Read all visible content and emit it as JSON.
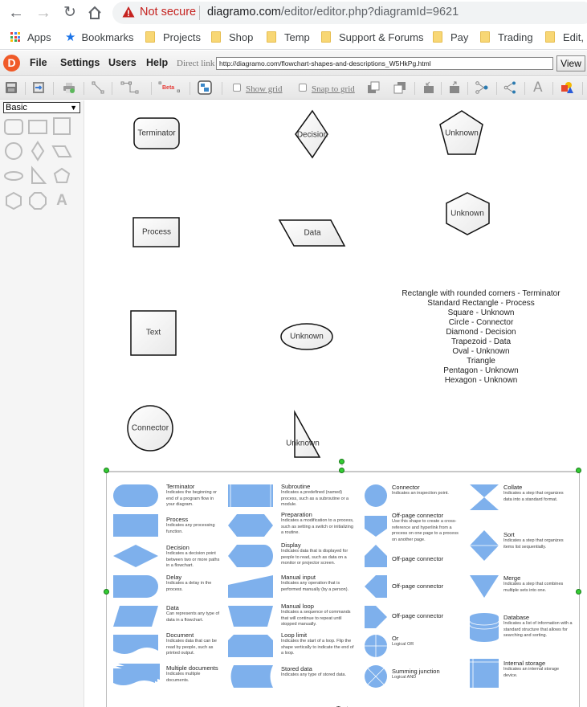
{
  "browser": {
    "security_label": "Not secure",
    "url_host": "diagramo.com",
    "url_path": "/editor/editor.php?diagramId=9621",
    "bookmarks": [
      {
        "label": "Apps",
        "icon": "apps-grid-icon"
      },
      {
        "label": "Bookmarks",
        "icon": "star-icon"
      },
      {
        "label": "Projects",
        "icon": "folder-icon"
      },
      {
        "label": "Shop",
        "icon": "folder-icon"
      },
      {
        "label": "Temp",
        "icon": "folder-icon"
      },
      {
        "label": "Support & Forums",
        "icon": "folder-icon"
      },
      {
        "label": "Pay",
        "icon": "folder-icon"
      },
      {
        "label": "Trading",
        "icon": "folder-icon"
      },
      {
        "label": "Edit, P",
        "icon": "folder-icon"
      }
    ]
  },
  "app": {
    "logo_letter": "D",
    "menu": [
      "File",
      "Settings",
      "Users",
      "Help"
    ],
    "direct_link_label": "Direct link :",
    "direct_link_value": "http://diagramo.com/flowchart-shapes-and-descriptions_W5HkPg.html",
    "view_button": "View",
    "toolbar": {
      "show_grid": "Show grid",
      "snap_to_grid": "Snap to grid",
      "beta_label": "Beta",
      "text_tool": "A"
    },
    "sidebar": {
      "shape_set": "Basic",
      "dropdown_arrow": "▼",
      "text_shape": "A"
    }
  },
  "canvas": {
    "figures": {
      "terminator": "Terminator",
      "decision": "Decision",
      "pentagon": "Unknown",
      "process": "Process",
      "data": "Data",
      "hexagon": "Unknown",
      "square": "Text",
      "oval": "Unknown",
      "circle": "Connector",
      "triangle": "Unknown"
    },
    "legend_lines": [
      "Rectangle with rounded corners - Terminator",
      "Standard Rectangle - Process",
      "Square - Unknown",
      "Circle - Connector",
      "Diamond - Decision",
      "Trapezoid - Data",
      "Oval - Unknown",
      "Triangle",
      "Pentagon - Unknown",
      "Hexagon - Unknown"
    ],
    "bottom_partial_label": "Text",
    "reference_image": {
      "shape_color": "#7eb0ec",
      "columns": [
        [
          {
            "title": "Terminator",
            "desc": "Indicates the beginning or end of a program flow in your diagram."
          },
          {
            "title": "Process",
            "desc": "Indicates any processing function."
          },
          {
            "title": "Decision",
            "desc": "Indicates a decision point between two or more paths in a flowchart."
          },
          {
            "title": "Delay",
            "desc": "Indicates a delay in the process."
          },
          {
            "title": "Data",
            "desc": "Can represents any type of data in a flowchart."
          },
          {
            "title": "Document",
            "desc": "Indicates data that can be read by people, such as printed output."
          },
          {
            "title": "Multiple documents",
            "desc": "Indicates multiple documents."
          }
        ],
        [
          {
            "title": "Subroutine",
            "desc": "Indicates a predefined (named) process, such as a subroutine or a module."
          },
          {
            "title": "Preparation",
            "desc": "Indicates a modification to a process, such as setting a switch or initializing a routine."
          },
          {
            "title": "Display",
            "desc": "Indicates data that is displayed for people to read, such as data on a monitor or projector screen."
          },
          {
            "title": "Manual input",
            "desc": "Indicates any operation that is performed manually (by a person)."
          },
          {
            "title": "Manual loop",
            "desc": "Indicates a sequence of commands that will continue to repeat until stopped manually."
          },
          {
            "title": "Loop limit",
            "desc": "Indicates the start of a loop. Flip the shape vertically to indicate the end of a loop."
          },
          {
            "title": "Stored data",
            "desc": "Indicates any type of stored data."
          }
        ],
        [
          {
            "title": "Connector",
            "desc": "Indicates an inspection point."
          },
          {
            "title": "Off-page connector",
            "desc": "Use this shape to create a cross-reference and hyperlink from a process on one page to a process on another page."
          },
          {
            "title": "Off-page connector",
            "desc": ""
          },
          {
            "title": "Off-page connector",
            "desc": ""
          },
          {
            "title": "Off-page connector",
            "desc": ""
          },
          {
            "title": "Or",
            "desc": "Logical OR"
          },
          {
            "title": "Summing junction",
            "desc": "Logical AND"
          }
        ],
        [
          {
            "title": "Collate",
            "desc": "Indicates a step that organizes data into a standard format."
          },
          {
            "title": "Sort",
            "desc": "Indicates a step that organizes items list sequentially."
          },
          {
            "title": "Merge",
            "desc": "Indicates a step that combines multiple sets into one."
          },
          {
            "title": "Database",
            "desc": "Indicates a list of information with a standard structure that allows for searching and sorting."
          },
          {
            "title": "Internal storage",
            "desc": "Indicates an internal storage device."
          }
        ]
      ]
    }
  }
}
